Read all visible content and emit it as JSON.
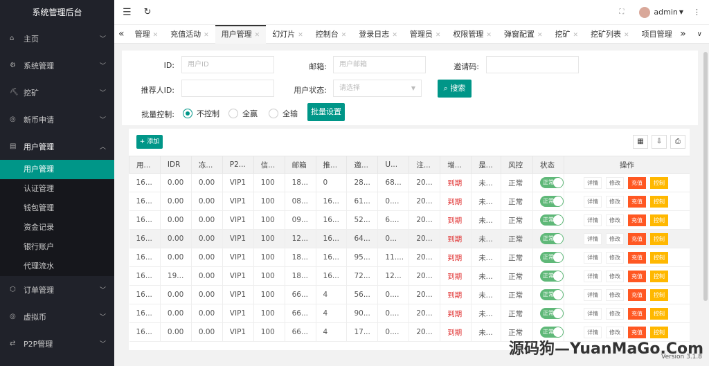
{
  "app_title": "系统管理后台",
  "sidebar": {
    "items": [
      {
        "label": "主页",
        "icon": "home-icon"
      },
      {
        "label": "系统管理",
        "icon": "gear-icon"
      },
      {
        "label": "挖矿",
        "icon": "pickaxe-icon"
      },
      {
        "label": "新币申请",
        "icon": "coin-icon"
      },
      {
        "label": "用户管理",
        "icon": "users-icon"
      }
    ],
    "sub_items": [
      "用户管理",
      "认证管理",
      "钱包管理",
      "资金记录",
      "银行账户",
      "代理流水"
    ],
    "bottom_items": [
      {
        "label": "订单管理",
        "icon": "box-icon"
      },
      {
        "label": "虚拟币",
        "icon": "coin-icon"
      },
      {
        "label": "P2P管理",
        "icon": "p2p-icon"
      }
    ]
  },
  "header": {
    "user": "admin"
  },
  "tabs": [
    {
      "label": "管理"
    },
    {
      "label": "充值活动"
    },
    {
      "label": "用户管理",
      "active": true
    },
    {
      "label": "幻灯片"
    },
    {
      "label": "控制台"
    },
    {
      "label": "登录日志"
    },
    {
      "label": "管理员"
    },
    {
      "label": "权限管理"
    },
    {
      "label": "弹窗配置"
    },
    {
      "label": "挖矿"
    },
    {
      "label": "挖矿列表"
    },
    {
      "label": "项目管理"
    }
  ],
  "form": {
    "id_label": "ID:",
    "id_ph": "用户ID",
    "email_label": "邮箱:",
    "email_ph": "用户邮箱",
    "invite_label": "邀请码:",
    "ref_label": "推荐人ID:",
    "status_label": "用户状态:",
    "status_ph": "请选择",
    "search": "搜索",
    "batch_label": "批量控制:",
    "radios": [
      "不控制",
      "全赢",
      "全输"
    ],
    "batch_btn": "批量设置"
  },
  "toolbar": {
    "add": "添加"
  },
  "table": {
    "headers": [
      "用...",
      "IDR",
      "冻...",
      "P2...",
      "信...",
      "邮箱",
      "推...",
      "邀...",
      "U...",
      "注...",
      "增...",
      "是...",
      "风控",
      "状态",
      "操作"
    ],
    "rows": [
      [
        "16...",
        "0.00",
        "0.00",
        "VIP1",
        "100",
        "18...",
        "0",
        "28...",
        "68...",
        "20...",
        "到期",
        "未...",
        "正常"
      ],
      [
        "16...",
        "0.00",
        "0.00",
        "VIP1",
        "100",
        "08...",
        "16...",
        "61...",
        "0....",
        "20...",
        "到期",
        "未...",
        "正常"
      ],
      [
        "16...",
        "0.00",
        "0.00",
        "VIP1",
        "100",
        "09...",
        "16...",
        "52...",
        "6....",
        "20...",
        "到期",
        "未...",
        "正常"
      ],
      [
        "16...",
        "0.00",
        "0.00",
        "VIP1",
        "100",
        "12...",
        "16...",
        "64...",
        "0...",
        "20...",
        "到期",
        "未...",
        "正常"
      ],
      [
        "16...",
        "0.00",
        "0.00",
        "VIP1",
        "100",
        "18...",
        "16...",
        "95...",
        "11....",
        "20...",
        "到期",
        "未...",
        "正常"
      ],
      [
        "16...",
        "19...",
        "0.00",
        "VIP1",
        "100",
        "18...",
        "16...",
        "72...",
        "12...",
        "20...",
        "到期",
        "未...",
        "正常"
      ],
      [
        "16...",
        "0.00",
        "0.00",
        "VIP1",
        "100",
        "66...",
        "4",
        "56...",
        "0....",
        "20...",
        "到期",
        "未...",
        "正常"
      ],
      [
        "16...",
        "0.00",
        "0.00",
        "VIP1",
        "100",
        "66...",
        "4",
        "90...",
        "0....",
        "20...",
        "到期",
        "未...",
        "正常"
      ],
      [
        "16...",
        "0.00",
        "0.00",
        "VIP1",
        "100",
        "66...",
        "4",
        "17...",
        "0....",
        "20...",
        "到期",
        "未...",
        "正常"
      ]
    ],
    "status": "正常",
    "actions": [
      "详情",
      "修改",
      "充值",
      "控制"
    ]
  },
  "watermark": "源码狗—YuanMaGo.Com",
  "version": "Version 3.1.8"
}
